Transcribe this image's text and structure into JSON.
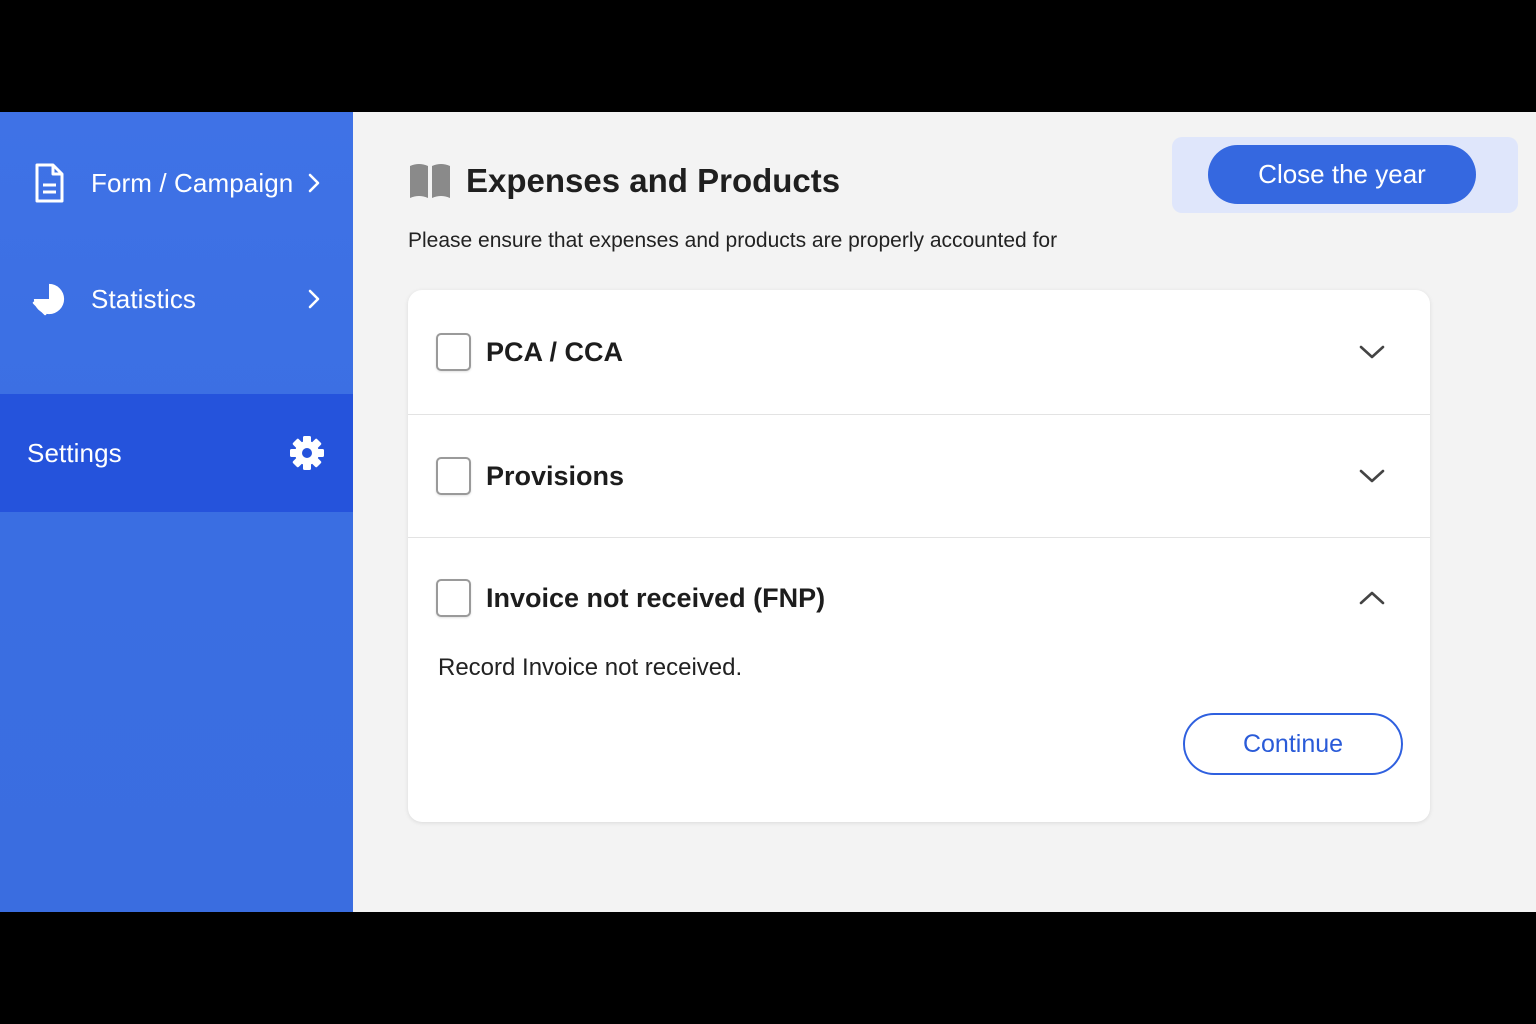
{
  "sidebar": {
    "items": [
      {
        "label": "Form / Campaign",
        "icon": "document-icon"
      },
      {
        "label": "Statistics",
        "icon": "pie-chart-icon"
      },
      {
        "label": "Settings",
        "icon": "gear-icon",
        "active": true
      }
    ]
  },
  "header": {
    "title": "Expenses and Products",
    "subtitle": "Please ensure that expenses and products are properly accounted for",
    "icon": "book-icon",
    "close_year_label": "Close the year"
  },
  "accordion": {
    "items": [
      {
        "label": "PCA / CCA",
        "checked": false,
        "expanded": false
      },
      {
        "label": "Provisions",
        "checked": false,
        "expanded": false
      },
      {
        "label": "Invoice not received (FNP)",
        "checked": false,
        "expanded": true,
        "body": "Record Invoice not received.",
        "action_label": "Continue"
      }
    ]
  },
  "colors": {
    "sidebar": "#3a6ee2",
    "sidebar_active": "#2553dc",
    "primary": "#3568e0",
    "main_bg": "#f3f3f3"
  }
}
